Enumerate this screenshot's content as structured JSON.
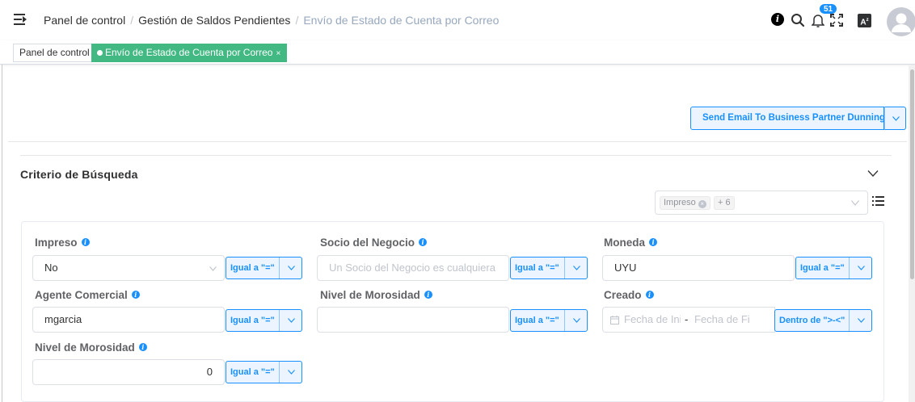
{
  "header": {
    "breadcrumbs": [
      "Panel de control",
      "Gestión de Saldos Pendientes",
      "Envío de Estado de Cuenta por Correo"
    ],
    "separator": "/",
    "notification_count": "51",
    "lang_icon_text": "A",
    "icons": [
      "menu-icon",
      "info-icon",
      "search-icon",
      "bell-icon",
      "fullscreen-icon",
      "language-icon",
      "avatar-icon"
    ]
  },
  "tabs": {
    "items": [
      {
        "label": "Panel de control",
        "active": false
      },
      {
        "label": "Envío de Estado de Cuenta por Correo",
        "active": true
      }
    ],
    "close_glyph": "×"
  },
  "toolbar": {
    "action_label": "Send Email To Business Partner Dunning"
  },
  "search": {
    "title": "Criterio de Búsqueda",
    "selected_chips": [
      "Impreso",
      "+ 6"
    ],
    "fields": {
      "impreso": {
        "label": "Impreso",
        "value": "No",
        "operator": "Igual a \"=\""
      },
      "socio": {
        "label": "Socio del Negocio",
        "placeholder": "Un Socio del Negocio es cualquiera",
        "operator": "Igual a \"=\""
      },
      "moneda": {
        "label": "Moneda",
        "value": "UYU",
        "operator": "Igual a \"=\""
      },
      "agente": {
        "label": "Agente Comercial",
        "value": "mgarcia",
        "operator": "Igual a \"=\""
      },
      "nivel_morosidad_1": {
        "label": "Nivel de Morosidad",
        "value": "",
        "operator": "Igual a \"=\""
      },
      "creado": {
        "label": "Creado",
        "start_placeholder": "Fecha de Ini",
        "range_sep": "-",
        "end_placeholder": "Fecha de Fi",
        "operator": "Dentro de \">-<\""
      },
      "nivel_morosidad_2": {
        "label": "Nivel de Morosidad",
        "value": "0",
        "operator": "Igual a \"=\""
      }
    }
  },
  "colors": {
    "accent": "#1890ff",
    "active_tab": "#42b983"
  }
}
